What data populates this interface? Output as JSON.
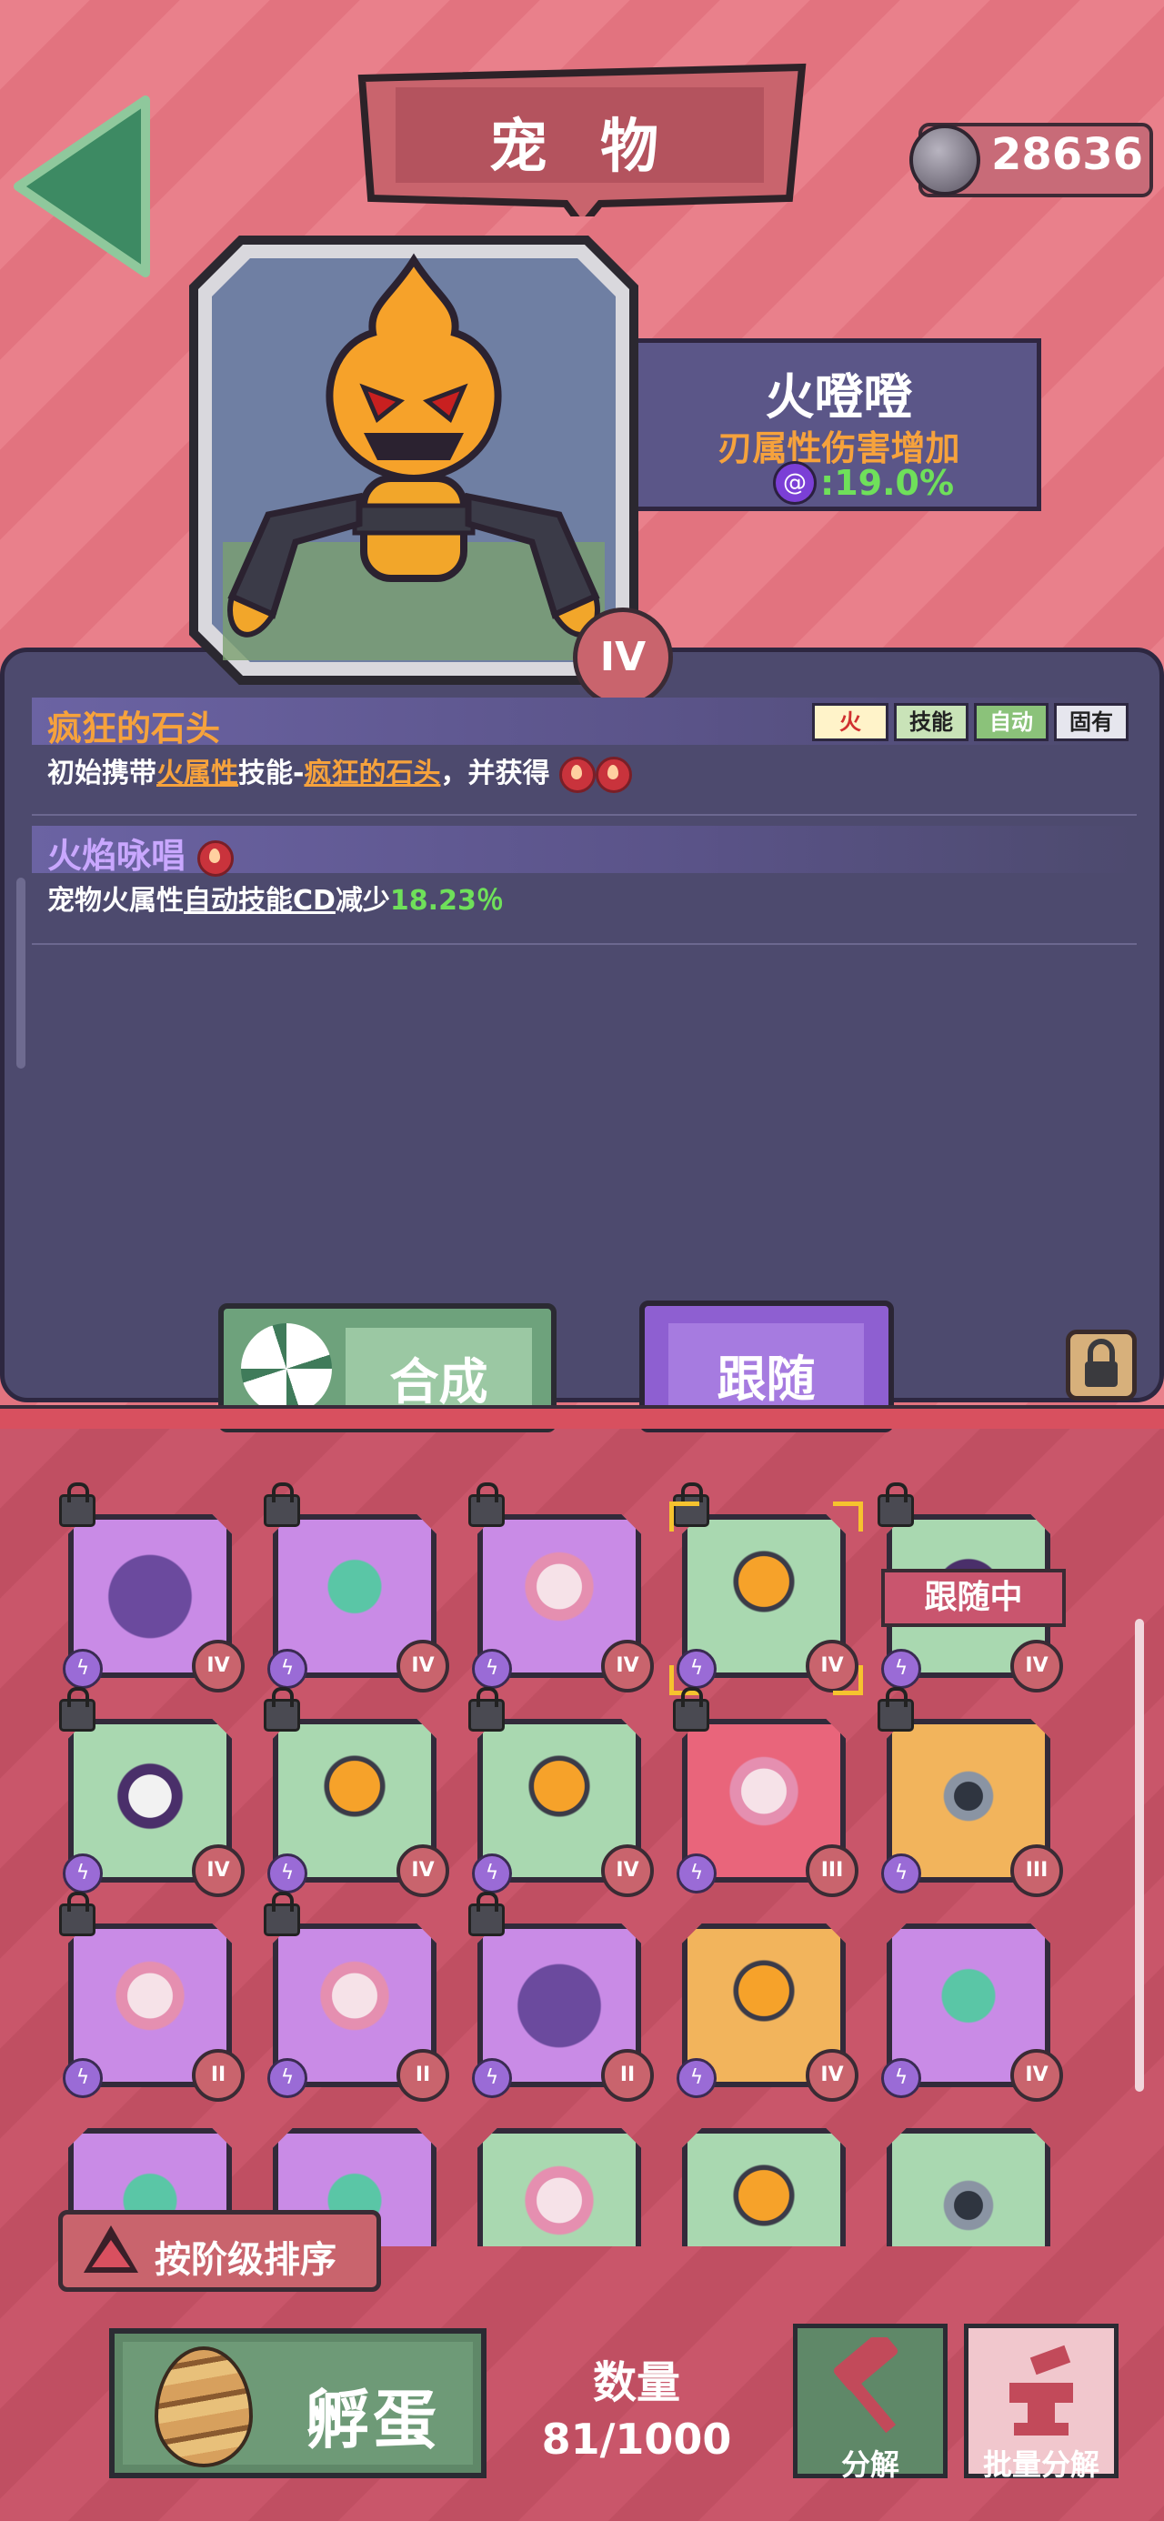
{
  "header": {
    "title": "宠 物",
    "currency_value": "28636"
  },
  "pet": {
    "name": "火噔噔",
    "attribute_label": "刃属性伤害增加",
    "attribute_value": ":19.0%",
    "tier": "IV"
  },
  "skills": [
    {
      "name": "疯狂的石头",
      "tags": [
        "火",
        "技能",
        "自动",
        "固有"
      ],
      "desc_prefix": "初始携带",
      "desc_link1": "火属性",
      "desc_mid": "技能-",
      "desc_link2": "疯狂的石头",
      "desc_suffix": "，并获得"
    },
    {
      "name": "火焰咏唱",
      "desc_prefix": "宠物火属性",
      "desc_link": "自动技能CD",
      "desc_mid": "减少",
      "desc_value": "18.23％"
    }
  ],
  "actions": {
    "combine": "合成",
    "follow": "跟随"
  },
  "grid": {
    "follow_banner": "跟随中",
    "cards": [
      {
        "creature": "purple-blob-icon",
        "color": "#c98be6",
        "tier": "IV",
        "locked": true
      },
      {
        "creature": "teal-spinner-icon",
        "color": "#c98be6",
        "tier": "IV",
        "locked": true
      },
      {
        "creature": "pink-fairy-icon",
        "color": "#c98be6",
        "tier": "IV",
        "locked": true
      },
      {
        "creature": "fire-pumpkin-icon",
        "color": "#a9d8b0",
        "tier": "IV",
        "locked": true,
        "selected": true
      },
      {
        "creature": "skull-ghost-icon",
        "color": "#a9d8b0",
        "tier": "IV",
        "locked": true,
        "following": true
      },
      {
        "creature": "skull-ghost-icon",
        "color": "#a9d8b0",
        "tier": "IV",
        "locked": true
      },
      {
        "creature": "fire-pumpkin-icon",
        "color": "#a9d8b0",
        "tier": "IV",
        "locked": true
      },
      {
        "creature": "fire-pumpkin-icon",
        "color": "#a9d8b0",
        "tier": "IV",
        "locked": true
      },
      {
        "creature": "pink-fairy-icon",
        "color": "#e9657b",
        "tier": "III",
        "locked": true
      },
      {
        "creature": "metal-spider-icon",
        "color": "#f2b45c",
        "tier": "III",
        "locked": true
      },
      {
        "creature": "pink-fairy-icon",
        "color": "#c98be6",
        "tier": "II",
        "locked": true
      },
      {
        "creature": "pink-fairy-icon",
        "color": "#c98be6",
        "tier": "II",
        "locked": true
      },
      {
        "creature": "purple-blob-icon",
        "color": "#c98be6",
        "tier": "II",
        "locked": true
      },
      {
        "creature": "fire-pumpkin-icon",
        "color": "#f2b45c",
        "tier": "IV",
        "locked": false
      },
      {
        "creature": "teal-spinner-icon",
        "color": "#c98be6",
        "tier": "IV",
        "locked": false
      },
      {
        "creature": "teal-spinner-icon",
        "color": "#c98be6",
        "tier": "",
        "locked": false
      },
      {
        "creature": "teal-spinner-icon",
        "color": "#c98be6",
        "tier": "",
        "locked": false
      },
      {
        "creature": "pink-fairy-icon",
        "color": "#a9d8b0",
        "tier": "",
        "locked": false
      },
      {
        "creature": "fire-pumpkin-icon",
        "color": "#a9d8b0",
        "tier": "",
        "locked": false
      },
      {
        "creature": "metal-spider-icon",
        "color": "#a9d8b0",
        "tier": "",
        "locked": false
      }
    ]
  },
  "sort": {
    "label": "按阶级排序"
  },
  "footer": {
    "hatch_label": "孵蛋",
    "count_label": "数量",
    "count_value": "81/1000",
    "decompose_label": "分解",
    "batch_decompose_label": "批量分解"
  }
}
